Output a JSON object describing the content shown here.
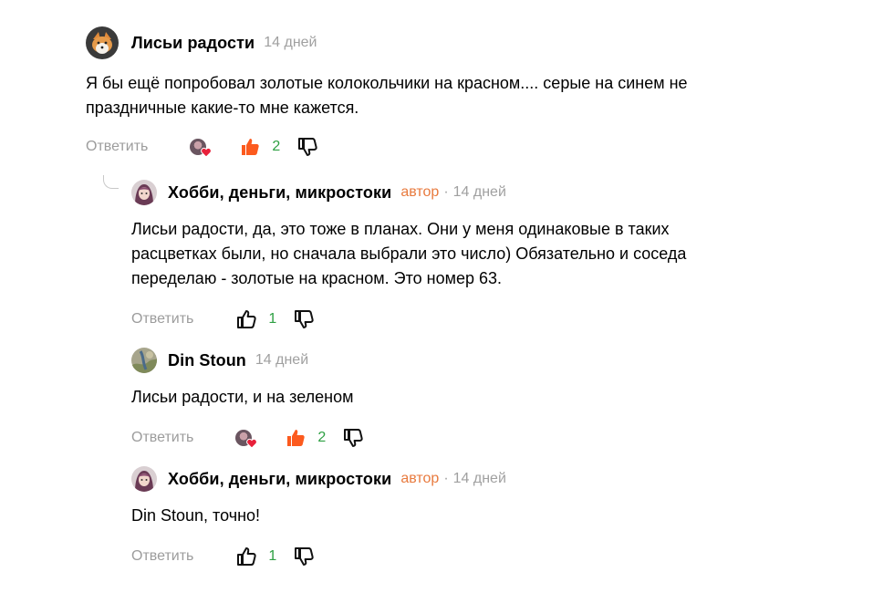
{
  "comments": [
    {
      "author": "Лисьи радости",
      "role": "",
      "time": "14 дней",
      "text_lines": [
        "Я бы ещё попробовал золотые колокольчики на красном.... серые на синем не",
        "праздничные какие-то мне кажется."
      ],
      "reply_label": "Ответить",
      "likes": "2",
      "liked": true,
      "has_reactions": true
    },
    {
      "author": "Хобби, деньги, микростоки",
      "role": "автор",
      "time": "14 дней",
      "text_lines": [
        "Лисьи радости, да, это тоже в планах. Они у меня одинаковые в таких",
        "расцветках были, но сначала выбрали это число) Обязательно и соседа",
        "переделаю - золотые на красном. Это номер 63."
      ],
      "reply_label": "Ответить",
      "likes": "1",
      "liked": false,
      "has_reactions": false
    },
    {
      "author": "Din Stoun",
      "role": "",
      "time": "14 дней",
      "text_lines": [
        "Лисьи радости, и на зеленом"
      ],
      "reply_label": "Ответить",
      "likes": "2",
      "liked": true,
      "has_reactions": true
    },
    {
      "author": "Хобби, деньги, микростоки",
      "role": "автор",
      "time": "14 дней",
      "text_lines": [
        "Din Stoun, точно!"
      ],
      "reply_label": "Ответить",
      "likes": "1",
      "liked": false,
      "has_reactions": false
    }
  ],
  "colors": {
    "accent_orange": "#fc5a1e",
    "count_green": "#2ea043",
    "author_role": "#e87a3e",
    "muted": "#9c9c9c"
  },
  "icons": {
    "like": "thumbs-up-icon",
    "dislike": "thumbs-down-icon",
    "reaction": "heart-icon"
  }
}
